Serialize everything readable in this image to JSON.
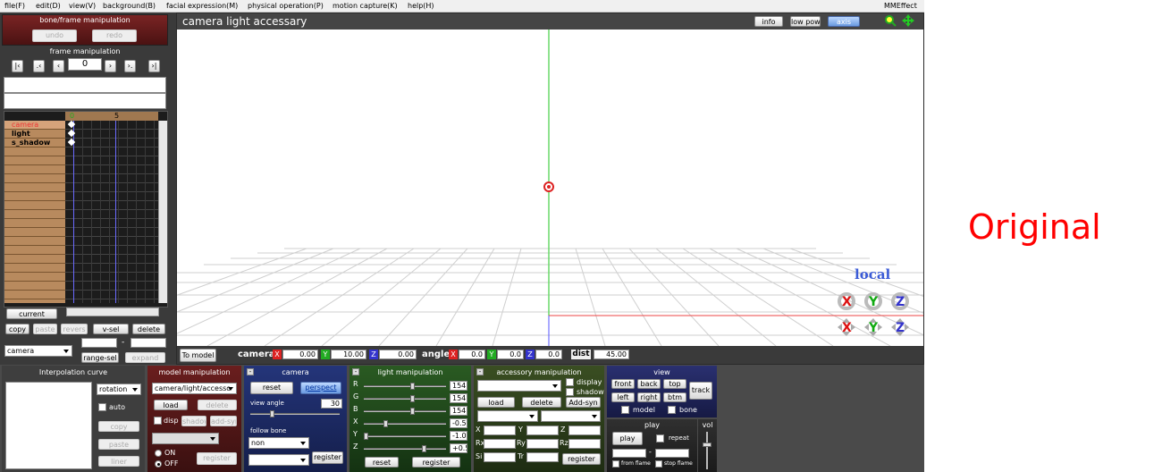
{
  "menu": [
    "file(F)",
    "edit(D)",
    "view(V)",
    "background(B)",
    "facial expression(M)",
    "physical operation(P)",
    "motion capture(K)",
    "help(H)"
  ],
  "menu_right": "MMEffect",
  "bone_panel": {
    "title": "bone/frame manipulation",
    "undo": "undo",
    "redo": "redo"
  },
  "frame_panel": {
    "title": "frame manipulation",
    "frame_value": "0",
    "ruler_start": "0",
    "ruler_mark": "5"
  },
  "tracks": [
    "camera",
    "light",
    "s_shadow"
  ],
  "timeline_buttons": {
    "current": "current",
    "copy": "copy",
    "paste": "paste",
    "revers": "revers",
    "vsel": "v-sel",
    "delete": "delete",
    "range_sel": "range-sel",
    "expand": "expand",
    "target": "camera",
    "range_dash": "-"
  },
  "viewport": {
    "title": "camera light accessary",
    "info": "info",
    "lowpow": "low pow",
    "axis": "axis",
    "local": "local"
  },
  "status": {
    "to_model": "To model",
    "camera": "camera",
    "cx": "0.00",
    "cy": "10.00",
    "cz": "0.00",
    "angle": "angle",
    "ax": "0.0",
    "ay": "0.0",
    "az": "0.0",
    "dist": "dist",
    "dist_val": "45.00",
    "X": "X",
    "Y": "Y",
    "Z": "Z"
  },
  "interp": {
    "title": "Interpolation curve",
    "mode": "rotation",
    "auto": "auto",
    "copy": "copy",
    "paste": "paste",
    "liner": "liner"
  },
  "model": {
    "title": "model manipulation",
    "target": "camera/light/accesso",
    "load": "load",
    "delete": "delete",
    "disp": "disp",
    "shadow": "shadow",
    "addsyn": "add-syn",
    "on": "ON",
    "off": "OFF",
    "register": "register"
  },
  "camera": {
    "title": "camera",
    "reset": "reset",
    "perspect": "perspect",
    "view_angle": "view angle",
    "view_angle_val": "30",
    "follow_bone": "follow bone",
    "follow_val": "non",
    "register": "register"
  },
  "light": {
    "title": "light manipulation",
    "rows": [
      {
        "k": "R",
        "v": "154",
        "p": 0.6
      },
      {
        "k": "G",
        "v": "154",
        "p": 0.6
      },
      {
        "k": "B",
        "v": "154",
        "p": 0.6
      },
      {
        "k": "X",
        "v": "-0.5",
        "p": 0.25
      },
      {
        "k": "Y",
        "v": "-1.0",
        "p": 0.0
      },
      {
        "k": "Z",
        "v": "+0.5",
        "p": 0.75
      }
    ],
    "reset": "reset",
    "register": "register"
  },
  "accessory": {
    "title": "accessory manipulation",
    "display": "display",
    "shadow": "shadow",
    "load": "load",
    "delete": "delete",
    "addsyn": "Add-syn",
    "fields": [
      "X",
      "Y",
      "Z",
      "Rx",
      "Ry",
      "Rz",
      "Si",
      "Tr"
    ],
    "register": "register"
  },
  "view": {
    "title": "view",
    "front": "front",
    "back": "back",
    "top": "top",
    "left": "left",
    "right": "right",
    "btm": "btm",
    "track": "track",
    "model": "model",
    "bone": "bone"
  },
  "play": {
    "title": "play",
    "play": "play",
    "repeat": "repeat",
    "from_frame": "from flame",
    "stop_frame": "stop flame",
    "dash": "-"
  },
  "vol": {
    "title": "vol"
  },
  "overlay_label": "Original",
  "colors": {
    "panel_dark": "#2a2a2a",
    "bone_panel": "#5a1616",
    "model_panel": "#5a1616",
    "camera_panel": "#1a2a66",
    "light_panel": "#1f4a1a",
    "accessory_panel": "#2e3f1c",
    "view_panel": "#22285a",
    "timeline_row": "#b88a5e"
  }
}
